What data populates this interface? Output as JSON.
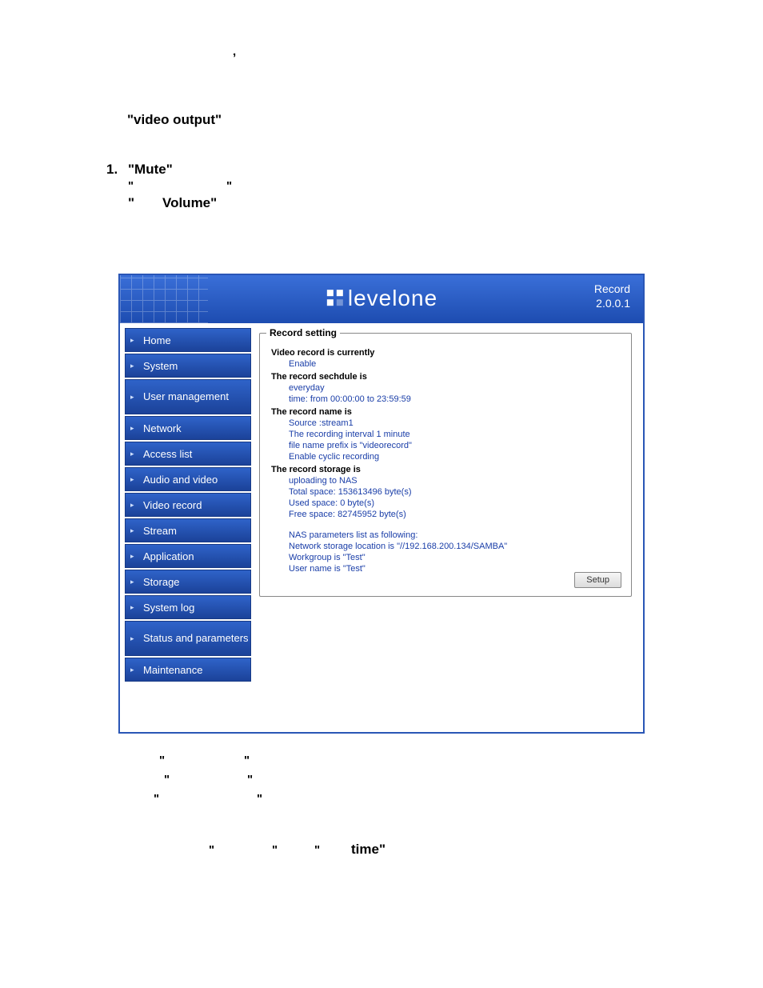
{
  "doc": {
    "video_output": "\"video output\"",
    "mute_num": "1.",
    "mute": "\"Mute\"",
    "open_q1": "\"",
    "close_q1": "\"",
    "open_q2": "\"",
    "volume": "Volume\"",
    "bq1_l": "\"",
    "bq1_r": "\"",
    "bq2_l": "\"",
    "bq2_r": "\"",
    "bq3_l": "\"",
    "bq3_r": "\"",
    "bq4_l": "\"",
    "bq4_r": "\"",
    "bq5_l": "\"",
    "time": "time\""
  },
  "header": {
    "brand": "levelone",
    "title": "Record",
    "version": "2.0.0.1"
  },
  "sidebar": {
    "items": [
      {
        "label": "Home",
        "tall": false
      },
      {
        "label": "System",
        "tall": false
      },
      {
        "label": "User management",
        "tall": true
      },
      {
        "label": "Network",
        "tall": false
      },
      {
        "label": "Access list",
        "tall": false
      },
      {
        "label": "Audio and video",
        "tall": false
      },
      {
        "label": "Video record",
        "tall": false
      },
      {
        "label": "Stream",
        "tall": false
      },
      {
        "label": "Application",
        "tall": false
      },
      {
        "label": "Storage",
        "tall": false
      },
      {
        "label": "System log",
        "tall": false
      },
      {
        "label": "Status and parameters",
        "tall": true
      },
      {
        "label": "Maintenance",
        "tall": false
      }
    ]
  },
  "panel": {
    "legend": "Record setting",
    "sec1_label": "Video record is currently",
    "sec1_v1": "Enable",
    "sec2_label": "The record sechdule is",
    "sec2_v1": "everyday",
    "sec2_v2": "time: from 00:00:00 to 23:59:59",
    "sec3_label": "The record name is",
    "sec3_v1": "Source :stream1",
    "sec3_v2": "The recording interval 1 minute",
    "sec3_v3": "file name prefix is \"videorecord\"",
    "sec3_v4": "Enable cyclic recording",
    "sec4_label": "The record storage is",
    "sec4_v1": "uploading to NAS",
    "sec4_v2": "Total space: 153613496 byte(s)",
    "sec4_v3": "Used space: 0 byte(s)",
    "sec4_v4": "Free space: 82745952 byte(s)",
    "sec4_v5": "NAS parameters list as following:",
    "sec4_v6": "Network storage location is \"//192.168.200.134/SAMBA\"",
    "sec4_v7": "Workgroup is \"Test\"",
    "sec4_v8": "User name is \"Test\"",
    "setup": "Setup"
  }
}
